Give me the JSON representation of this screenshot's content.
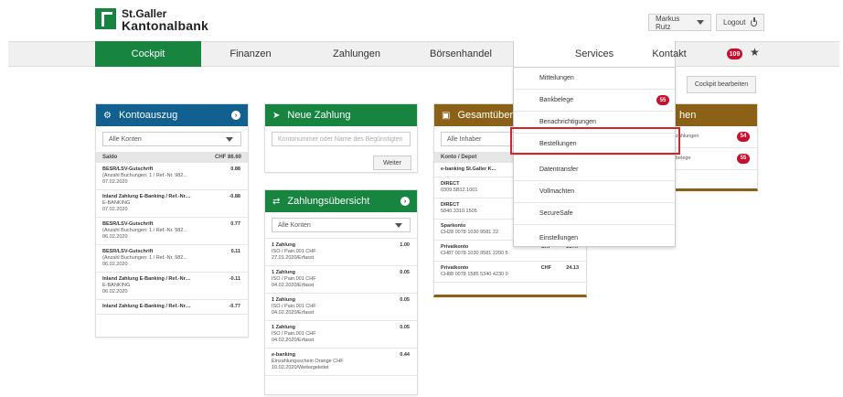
{
  "logo": {
    "line1": "St.Galler",
    "line2": "Kantonalbank"
  },
  "header": {
    "user": "Markus Rutz",
    "logout": "Logout"
  },
  "nav": {
    "items": [
      "Cockpit",
      "Finanzen",
      "Zahlungen",
      "Börsenhandel",
      "Services",
      "Kontakt"
    ],
    "badge": "109"
  },
  "edit_button": "Cockpit bearbeiten",
  "konto": {
    "title": "Kontoauszug",
    "select": "Alle Konten",
    "col_saldo": "Saldo",
    "col_value": "CHF 86.60",
    "rows": [
      {
        "t": "BESR/LSV-Gutschrift",
        "d": "(Anzahl Buchungen: 1 / Ref.-Nr. 982...",
        "date": "07.02.2020",
        "amt": "0.88"
      },
      {
        "t": "Inland Zahlung E-Banking / Ref.-Nr....",
        "d": "E-BANKING",
        "date": "07.02.2020",
        "amt": "-0.88"
      },
      {
        "t": "BESR/LSV-Gutschrift",
        "d": "(Anzahl Buchungen: 1 / Ref.-Nr. 982...",
        "date": "06.02.2020",
        "amt": "0.77"
      },
      {
        "t": "BESR/LSV-Gutschrift",
        "d": "(Anzahl Buchungen: 1 / Ref.-Nr. 982...",
        "date": "06.02.2020",
        "amt": "0.11"
      },
      {
        "t": "Inland Zahlung E-Banking / Ref.-Nr....",
        "d": "E-BANKING",
        "date": "06.02.2020",
        "amt": "-0.11"
      },
      {
        "t": "Inland Zahlung E-Banking / Ref.-Nr....",
        "d": "",
        "date": "",
        "amt": "-0.77"
      }
    ]
  },
  "neue": {
    "title": "Neue Zahlung",
    "placeholder": "Kontonummer oder Name des Begünstigten",
    "button": "Weiter"
  },
  "uebersicht": {
    "title": "Zahlungsübersicht",
    "select": "Alle Konten",
    "rows": [
      {
        "t": "1 Zahlung",
        "d": "ISO / Pain.001 CHF",
        "date": "27.01.2020/Erfasst",
        "amt": "1.00"
      },
      {
        "t": "1 Zahlung",
        "d": "ISO / Pain.001 CHF",
        "date": "04.02.2020/Erfasst",
        "amt": "0.05"
      },
      {
        "t": "1 Zahlung",
        "d": "ISO / Pain.001 CHF",
        "date": "04.02.2020/Erfasst",
        "amt": "0.05"
      },
      {
        "t": "1 Zahlung",
        "d": "ISO / Pain.001 CHF",
        "date": "04.02.2020/Erfasst",
        "amt": "0.05"
      },
      {
        "t": "e-banking",
        "d": "Einzahlungsschein Orange CHF",
        "date": "10.02.2020/Weitergeleitet",
        "amt": "0.44"
      }
    ]
  },
  "gesamt": {
    "title": "Gesamtübersi",
    "select": "Alle Inhaber",
    "col1": "Konto / Depot",
    "group": "e-banking St.Galler K...",
    "rows": [
      {
        "t": "DIRECT",
        "d": "0309.5B12.1001",
        "cur": "",
        "amt": ""
      },
      {
        "t": "DIRECT",
        "d": "5840.3310.1505",
        "cur": "",
        "amt": ""
      },
      {
        "t": "Sparkonto",
        "d": "CH28 0078 1030 9581 22",
        "cur": "",
        "amt": ""
      },
      {
        "t": "Privatkonto",
        "d": "CH87 0078 1030 9581 2200 5",
        "cur": "CHF",
        "amt": "33.47"
      },
      {
        "t": "Privatkonto",
        "d": "CH88 0078 1585 5340 4230 0",
        "cur": "CHF",
        "amt": "24.13"
      }
    ]
  },
  "nach": {
    "title": "hen",
    "items": [
      {
        "label": "zahlungen",
        "badge": "54"
      },
      {
        "label": "belege",
        "badge": "55"
      }
    ]
  },
  "menu": {
    "items": [
      {
        "label": "Mitteilungen",
        "badge": ""
      },
      {
        "label": "Bankbelege",
        "badge": "55"
      },
      {
        "label": "Benachrichtigungen",
        "badge": ""
      },
      {
        "label": "Bestellungen",
        "badge": ""
      },
      {
        "label": "Datentransfer",
        "badge": ""
      },
      {
        "label": "Vollmachten",
        "badge": ""
      },
      {
        "label": "SecureSafe",
        "badge": ""
      },
      {
        "label": "Einstellungen",
        "badge": ""
      }
    ]
  },
  "colors": {
    "green": "#17843f",
    "blue": "#12608f",
    "brown": "#8a6117",
    "red": "#c8102e"
  }
}
